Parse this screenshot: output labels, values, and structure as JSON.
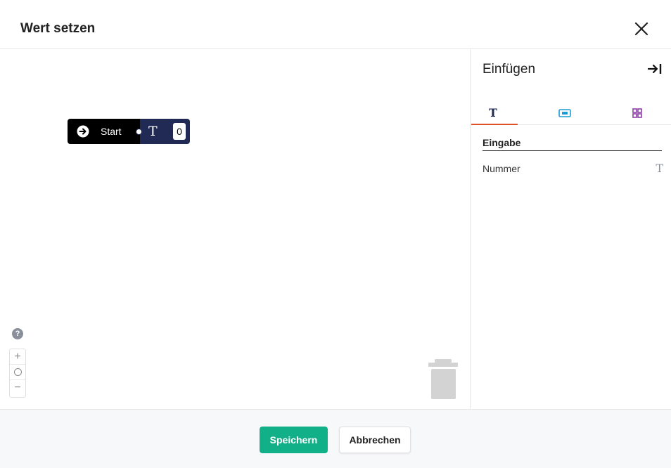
{
  "dialog": {
    "title": "Wert setzen"
  },
  "canvas": {
    "start_block": {
      "label": "Start",
      "color": "#000000"
    },
    "value_block": {
      "type_glyph": "T",
      "value": "0",
      "color": "#202a55"
    },
    "help_label": "?",
    "zoom": {
      "in": "+",
      "out": "−"
    }
  },
  "panel": {
    "title": "Einfügen",
    "tabs": [
      {
        "icon": "text-type-icon",
        "glyph": "T",
        "active": true
      },
      {
        "icon": "text-field-icon",
        "active": false
      },
      {
        "icon": "apps-grid-icon",
        "active": false
      }
    ],
    "section": "Eingabe",
    "items": [
      {
        "label": "Nummer",
        "icon": "text-type-icon",
        "glyph": "T"
      }
    ]
  },
  "footer": {
    "save_label": "Speichern",
    "cancel_label": "Abbrechen"
  },
  "colors": {
    "accent": "#12b089",
    "tab_indicator": "#e0522a",
    "navy": "#202a55"
  }
}
